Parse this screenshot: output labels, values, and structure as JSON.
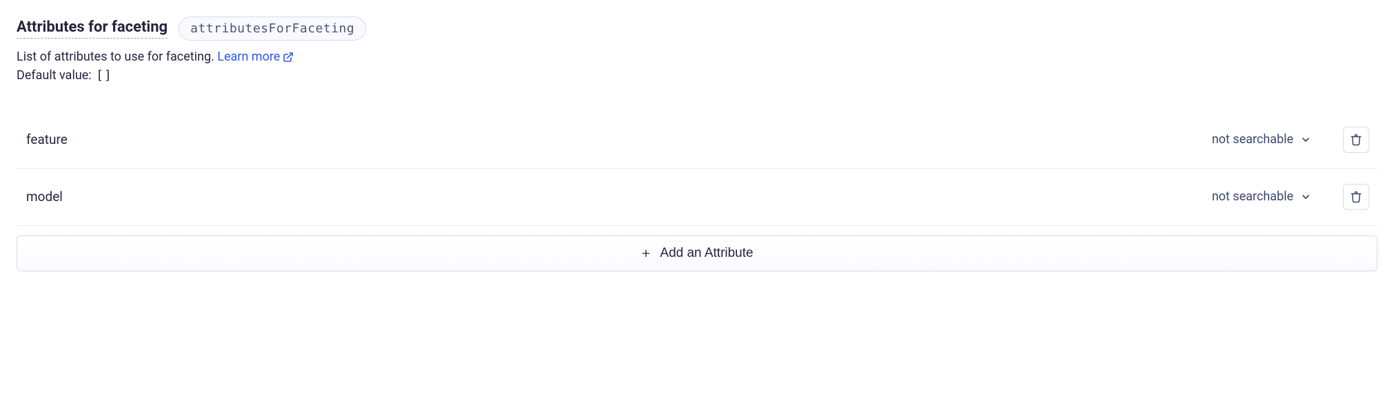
{
  "header": {
    "title": "Attributes for faceting",
    "api_name": "attributesForFaceting"
  },
  "description": {
    "text": "List of attributes to use for faceting.",
    "learn_more_label": "Learn more",
    "default_label": "Default value:",
    "default_value": "[]"
  },
  "attributes": [
    {
      "name": "feature",
      "mode": "not searchable"
    },
    {
      "name": "model",
      "mode": "not searchable"
    }
  ],
  "add_button_label": "Add an Attribute"
}
